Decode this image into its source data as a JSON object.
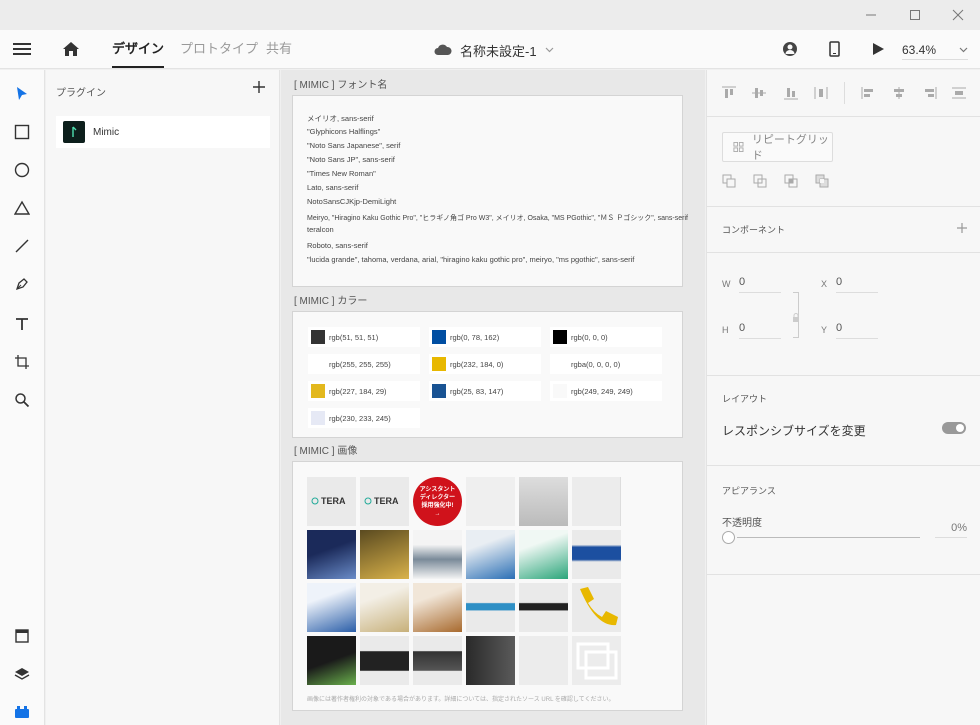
{
  "menubar": {
    "tabs": [
      "デザイン",
      "プロトタイプ",
      "共有"
    ],
    "active_tab": "デザイン",
    "doc_title": "名称未設定-1",
    "zoom": "63.4%"
  },
  "plugins": {
    "title": "プラグイン",
    "item": "Mimic"
  },
  "canvas": {
    "font_board": {
      "label": "[ MIMIC ] フォント名",
      "fonts": [
        "メイリオ, sans-serif",
        "\"Glyphicons Halflings\"",
        "\"Noto Sans Japanese\", serif",
        "\"Noto Sans JP\", sans-serif",
        "\"Times New Roman\"",
        "Lato, sans-serif",
        "NotoSansCJKjp-DemiLight",
        "Meiryo, \"Hiragino Kaku Gothic Pro\", \"ヒラギノ角ゴ Pro W3\", メイリオ, Osaka, \"MS PGothic\", \"ＭＳ Ｐゴシック\", sans-serif",
        "teralcon",
        "Roboto, sans-serif",
        "\"lucida grande\", tahoma, verdana, arial, \"hiragino kaku gothic pro\", meiryo, \"ms pgothic\", sans-serif"
      ]
    },
    "color_board": {
      "label": "[ MIMIC ] カラー",
      "colors": [
        {
          "text": "rgb(51, 51, 51)",
          "hex": "#333333"
        },
        {
          "text": "rgb(0, 78, 162)",
          "hex": "#004ea2"
        },
        {
          "text": "rgb(0, 0, 0)",
          "hex": "#000000"
        },
        {
          "text": "rgb(255, 255, 255)",
          "hex": "#ffffff"
        },
        {
          "text": "rgb(232, 184, 0)",
          "hex": "#e8b800"
        },
        {
          "text": "rgba(0, 0, 0, 0)",
          "hex": "transparent"
        },
        {
          "text": "rgb(227, 184, 29)",
          "hex": "#e3b81d"
        },
        {
          "text": "rgb(25, 83, 147)",
          "hex": "#195393"
        },
        {
          "text": "rgb(249, 249, 249)",
          "hex": "#f9f9f9"
        },
        {
          "text": "rgb(230, 233, 245)",
          "hex": "#e6e9f5"
        }
      ]
    },
    "image_board": {
      "label": "[ MIMIC ] 画像",
      "badge": {
        "line1": "アシスタント",
        "line2": "ディレクター",
        "line3": "採用強化中!",
        "arrow": "→"
      },
      "tera_logo": "TERA",
      "note": "画像には著作者権利の対象である場合があります。詳細については、指定されたソース URL を確認してください。"
    }
  },
  "properties": {
    "repeat_grid": "リピートグリッド",
    "component": "コンポーネント",
    "w_label": "W",
    "w_value": "0",
    "x_label": "X",
    "x_value": "0",
    "h_label": "H",
    "h_value": "0",
    "y_label": "Y",
    "y_value": "0",
    "layout": "レイアウト",
    "responsive": "レスポンシブサイズを変更",
    "appearance": "アピアランス",
    "opacity_label": "不透明度",
    "opacity_value": "0%"
  },
  "colors": {
    "accent": "#1473e6",
    "badge_red": "#d0121b"
  }
}
